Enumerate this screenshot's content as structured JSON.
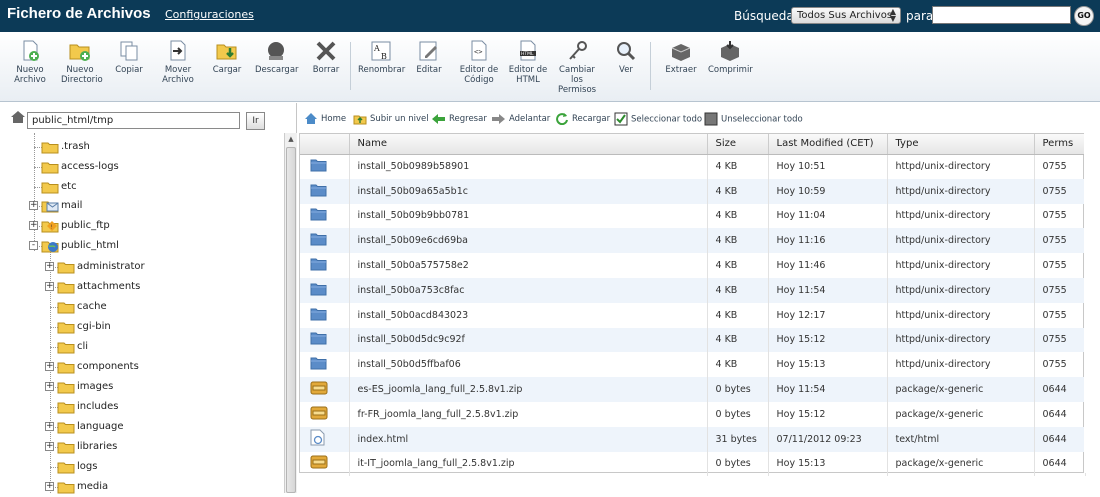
{
  "header": {
    "title": "Fichero de Archivos",
    "settings_link": "Configuraciones",
    "search_label": "Búsqueda",
    "search_scope": "Todos Sus Archivos",
    "para_label": "para",
    "search_value": "",
    "go_label": "GO"
  },
  "toolbar": {
    "new_file": [
      "Nuevo",
      "Archivo"
    ],
    "new_folder": [
      "Nuevo",
      "Directorio"
    ],
    "copy": [
      "Copiar"
    ],
    "move": [
      "Mover",
      "Archivo"
    ],
    "upload": [
      "Cargar"
    ],
    "download": [
      "Descargar"
    ],
    "delete": [
      "Borrar"
    ],
    "rename": [
      "Renombrar"
    ],
    "edit": [
      "Editar"
    ],
    "code_editor": [
      "Editor de",
      "Código"
    ],
    "html_editor": [
      "Editor de",
      "HTML"
    ],
    "permissions": [
      "Cambiar",
      "los",
      "Permisos"
    ],
    "view": [
      "Ver"
    ],
    "extract": [
      "Extraer"
    ],
    "compress": [
      "Comprimir"
    ]
  },
  "tree": {
    "path": "public_html/tmp",
    "go_label": "Ir",
    "items": [
      {
        "label": ".trash",
        "icon": "folder-icon"
      },
      {
        "label": "access-logs",
        "icon": "folder-icon"
      },
      {
        "label": "etc",
        "icon": "folder-icon"
      },
      {
        "label": "mail",
        "icon": "mail-folder-icon"
      },
      {
        "label": "public_ftp",
        "icon": "ftp-folder-icon"
      },
      {
        "label": "public_html",
        "icon": "globe-folder-icon"
      },
      {
        "label": "administrator",
        "icon": "folder-icon"
      },
      {
        "label": "attachments",
        "icon": "folder-icon"
      },
      {
        "label": "cache",
        "icon": "folder-icon"
      },
      {
        "label": "cgi-bin",
        "icon": "folder-icon"
      },
      {
        "label": "cli",
        "icon": "folder-icon"
      },
      {
        "label": "components",
        "icon": "folder-icon"
      },
      {
        "label": "images",
        "icon": "folder-icon"
      },
      {
        "label": "includes",
        "icon": "folder-icon"
      },
      {
        "label": "language",
        "icon": "folder-icon"
      },
      {
        "label": "libraries",
        "icon": "folder-icon"
      },
      {
        "label": "logs",
        "icon": "folder-icon"
      },
      {
        "label": "media",
        "icon": "folder-icon"
      }
    ]
  },
  "nav": {
    "home": "Home",
    "up": "Subir un nivel",
    "back": "Regresar",
    "forward": "Adelantar",
    "reload": "Recargar",
    "select_all": "Seleccionar todo",
    "unselect_all": "Unseleccionar todo"
  },
  "table": {
    "columns": [
      "Name",
      "Size",
      "Last Modified (CET)",
      "Type",
      "Perms"
    ],
    "rows": [
      {
        "icon": "folder-icon",
        "name": "install_50b0989b58901",
        "size": "4 KB",
        "modified": "Hoy 10:51",
        "type": "httpd/unix-directory",
        "perms": "0755"
      },
      {
        "icon": "folder-icon",
        "name": "install_50b09a65a5b1c",
        "size": "4 KB",
        "modified": "Hoy 10:59",
        "type": "httpd/unix-directory",
        "perms": "0755"
      },
      {
        "icon": "folder-icon",
        "name": "install_50b09b9bb0781",
        "size": "4 KB",
        "modified": "Hoy 11:04",
        "type": "httpd/unix-directory",
        "perms": "0755"
      },
      {
        "icon": "folder-icon",
        "name": "install_50b09e6cd69ba",
        "size": "4 KB",
        "modified": "Hoy 11:16",
        "type": "httpd/unix-directory",
        "perms": "0755"
      },
      {
        "icon": "folder-icon",
        "name": "install_50b0a575758e2",
        "size": "4 KB",
        "modified": "Hoy 11:46",
        "type": "httpd/unix-directory",
        "perms": "0755"
      },
      {
        "icon": "folder-icon",
        "name": "install_50b0a753c8fac",
        "size": "4 KB",
        "modified": "Hoy 11:54",
        "type": "httpd/unix-directory",
        "perms": "0755"
      },
      {
        "icon": "folder-icon",
        "name": "install_50b0acd843023",
        "size": "4 KB",
        "modified": "Hoy 12:17",
        "type": "httpd/unix-directory",
        "perms": "0755"
      },
      {
        "icon": "folder-icon",
        "name": "install_50b0d5dc9c92f",
        "size": "4 KB",
        "modified": "Hoy 15:12",
        "type": "httpd/unix-directory",
        "perms": "0755"
      },
      {
        "icon": "folder-icon",
        "name": "install_50b0d5ffbaf06",
        "size": "4 KB",
        "modified": "Hoy 15:13",
        "type": "httpd/unix-directory",
        "perms": "0755"
      },
      {
        "icon": "archive-icon",
        "name": "es-ES_joomla_lang_full_2.5.8v1.zip",
        "size": "0 bytes",
        "modified": "Hoy 11:54",
        "type": "package/x-generic",
        "perms": "0644"
      },
      {
        "icon": "archive-icon",
        "name": "fr-FR_joomla_lang_full_2.5.8v1.zip",
        "size": "0 bytes",
        "modified": "Hoy 15:12",
        "type": "package/x-generic",
        "perms": "0644"
      },
      {
        "icon": "html-file-icon",
        "name": "index.html",
        "size": "31 bytes",
        "modified": "07/11/2012 09:23",
        "type": "text/html",
        "perms": "0644"
      },
      {
        "icon": "archive-icon",
        "name": "it-IT_joomla_lang_full_2.5.8v1.zip",
        "size": "0 bytes",
        "modified": "Hoy 15:13",
        "type": "package/x-generic",
        "perms": "0644"
      }
    ]
  },
  "colors": {
    "header_bg": "#0c3a57",
    "row_alt": "#eef4fb",
    "folder_blue": "#5b8cc8",
    "folder_yellow": "#f2c94c"
  }
}
